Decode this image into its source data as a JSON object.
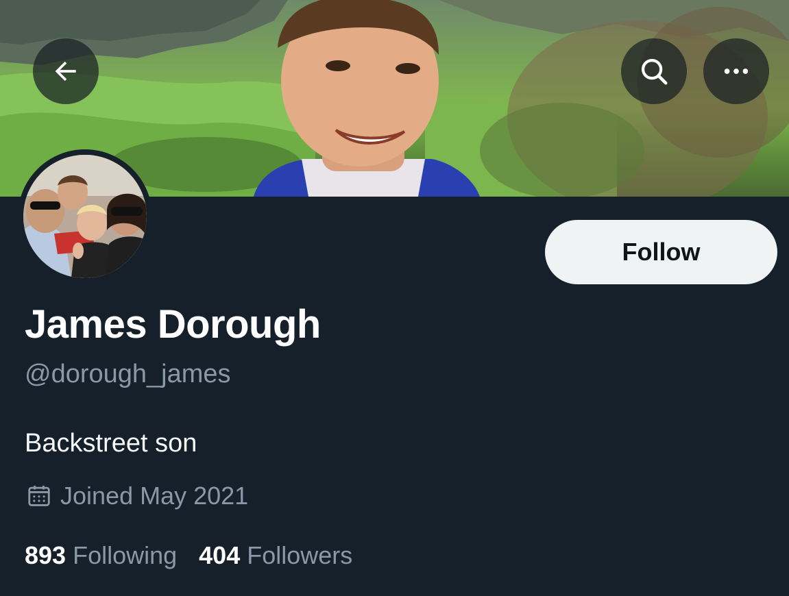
{
  "banner": {
    "back_icon": "arrow-left-icon",
    "search_icon": "search-icon",
    "more_icon": "more-horizontal-icon"
  },
  "profile": {
    "display_name": "James Dorough",
    "handle": "@dorough_james",
    "bio": "Backstreet son",
    "joined": "Joined May 2021",
    "joined_icon": "calendar-icon"
  },
  "actions": {
    "follow_label": "Follow"
  },
  "stats": {
    "following_count": "893",
    "following_label": "Following",
    "followers_count": "404",
    "followers_label": "Followers"
  },
  "colors": {
    "background": "#15202b",
    "primary_text": "#ffffff",
    "secondary_text": "#8b98a5",
    "follow_button_bg": "#eff3f4",
    "follow_button_text": "#0f1419"
  }
}
